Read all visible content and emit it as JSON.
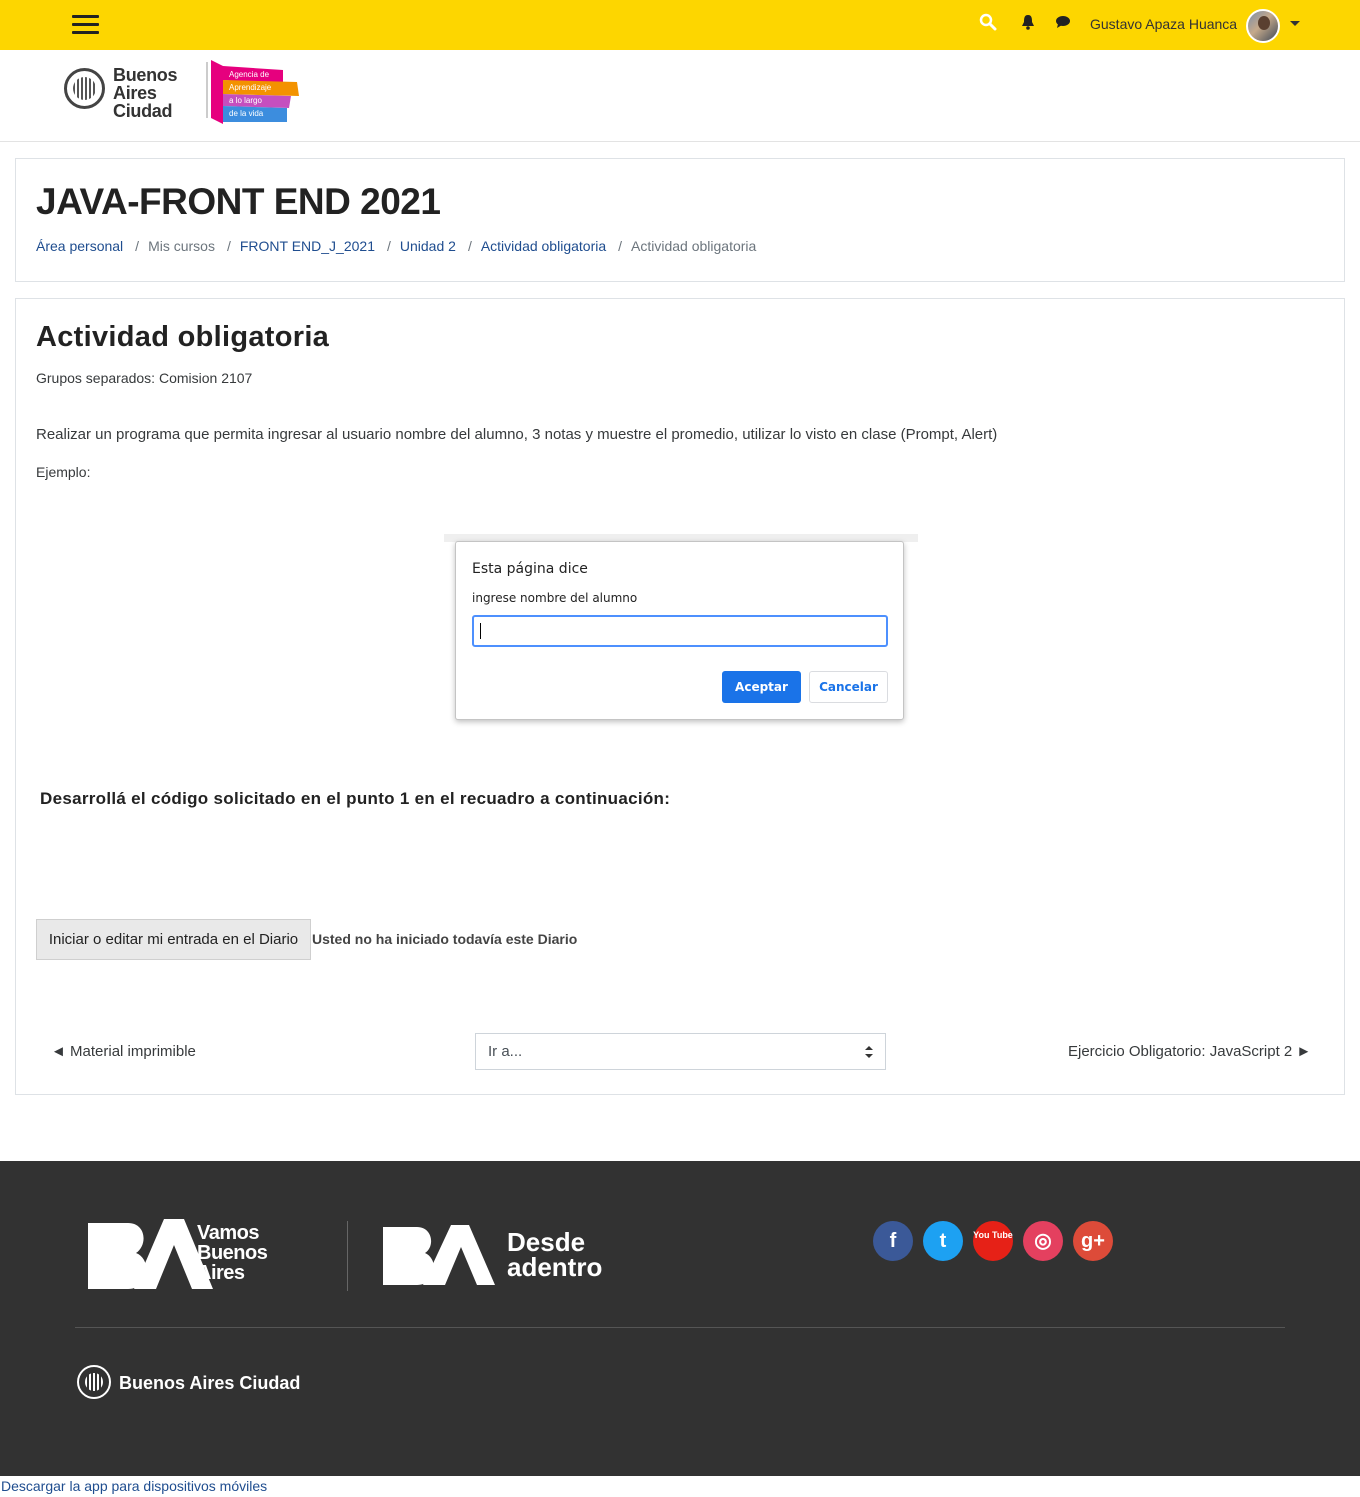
{
  "navbar": {
    "user_name": "Gustavo Apaza Huanca",
    "accent_color": "#fdd600"
  },
  "logo": {
    "line1": "Buenos",
    "line2": "Aires",
    "line3": "Ciudad",
    "agency_line1": "Agencia de",
    "agency_line2": "Aprendizaje",
    "agency_line3": "a lo largo",
    "agency_line4": "de la vida"
  },
  "course": {
    "title": "JAVA-FRONT END 2021"
  },
  "breadcrumb": {
    "items": [
      {
        "label": "Área personal"
      },
      {
        "label": "Mis cursos"
      },
      {
        "label": "FRONT END_J_2021"
      },
      {
        "label": "Unidad 2"
      },
      {
        "label": "Actividad obligatoria"
      },
      {
        "label": "Actividad obligatoria"
      }
    ]
  },
  "activity": {
    "title": "Actividad obligatoria",
    "groups": "Grupos separados: Comision 2107",
    "description": "Realizar un programa que permita ingresar al usuario nombre del alumno, 3 notas y muestre el promedio, utilizar lo visto en clase (Prompt, Alert)",
    "example_label": "Ejemplo:",
    "task_heading": "Desarrollá el código solicitado en el punto 1 en el recuadro a continuación:"
  },
  "dialog": {
    "title": "Esta página dice",
    "message": "ingrese nombre del alumno",
    "input_value": "",
    "ok_label": "Aceptar",
    "cancel_label": "Cancelar"
  },
  "diary": {
    "button_label": "Iniciar o editar mi entrada en el Diario",
    "status": "Usted no ha iniciado todavía este Diario"
  },
  "navigation": {
    "prev_label": "◄ Material imprimible",
    "jump_label": "Ir a...",
    "next_label": "Ejercicio Obligatorio: JavaScript 2 ►"
  },
  "footer": {
    "vamos_line1": "Vamos",
    "vamos_line2": "Buenos",
    "vamos_line3": "Aires",
    "desde_line1": "Desde",
    "desde_line2": "adentro",
    "city_label": "Buenos Aires Ciudad",
    "social": [
      {
        "icon": "facebook-icon",
        "glyph": "f",
        "color": "#3b5998"
      },
      {
        "icon": "twitter-icon",
        "glyph": "t",
        "color": "#1da1f2"
      },
      {
        "icon": "youtube-icon",
        "glyph": "You Tube",
        "color": "#e62117"
      },
      {
        "icon": "instagram-icon",
        "glyph": "◎",
        "color": "#e4405f"
      },
      {
        "icon": "google-plus-icon",
        "glyph": "g+",
        "color": "#dd4b39"
      }
    ],
    "app_link": "Descargar la app para dispositivos móviles"
  }
}
